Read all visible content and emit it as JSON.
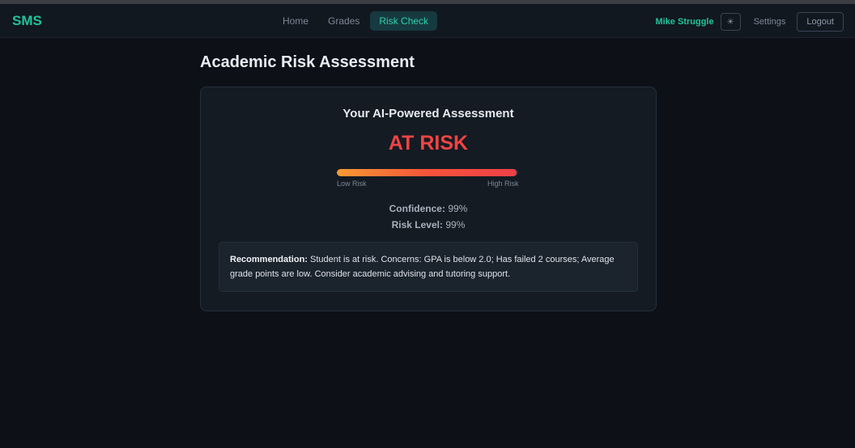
{
  "nav": {
    "brand": "SMS",
    "links": [
      {
        "label": "Home",
        "active": false
      },
      {
        "label": "Grades",
        "active": false
      },
      {
        "label": "Risk Check",
        "active": true
      }
    ],
    "user_name": "Mike Struggle",
    "theme_icon": "☀",
    "settings_label": "Settings",
    "logout_label": "Logout"
  },
  "page": {
    "title": "Academic Risk Assessment"
  },
  "assessment": {
    "heading": "Your AI-Powered Assessment",
    "status": "AT RISK",
    "status_color": "#ef4444",
    "risk_level_fraction": 0.99,
    "bar_low_label": "Low Risk",
    "bar_high_label": "High Risk",
    "confidence_label": "Confidence:",
    "confidence_value": "99%",
    "risk_level_label": "Risk Level:",
    "risk_level_value": "99%",
    "recommendation_label": "Recommendation:",
    "recommendation_text": "Student is at risk. Concerns: GPA is below 2.0; Has failed 2 courses; Average grade points are low. Consider academic advising and tutoring support."
  },
  "colors": {
    "accent": "#23c29a",
    "background": "#0d1017",
    "card": "#141b23"
  }
}
